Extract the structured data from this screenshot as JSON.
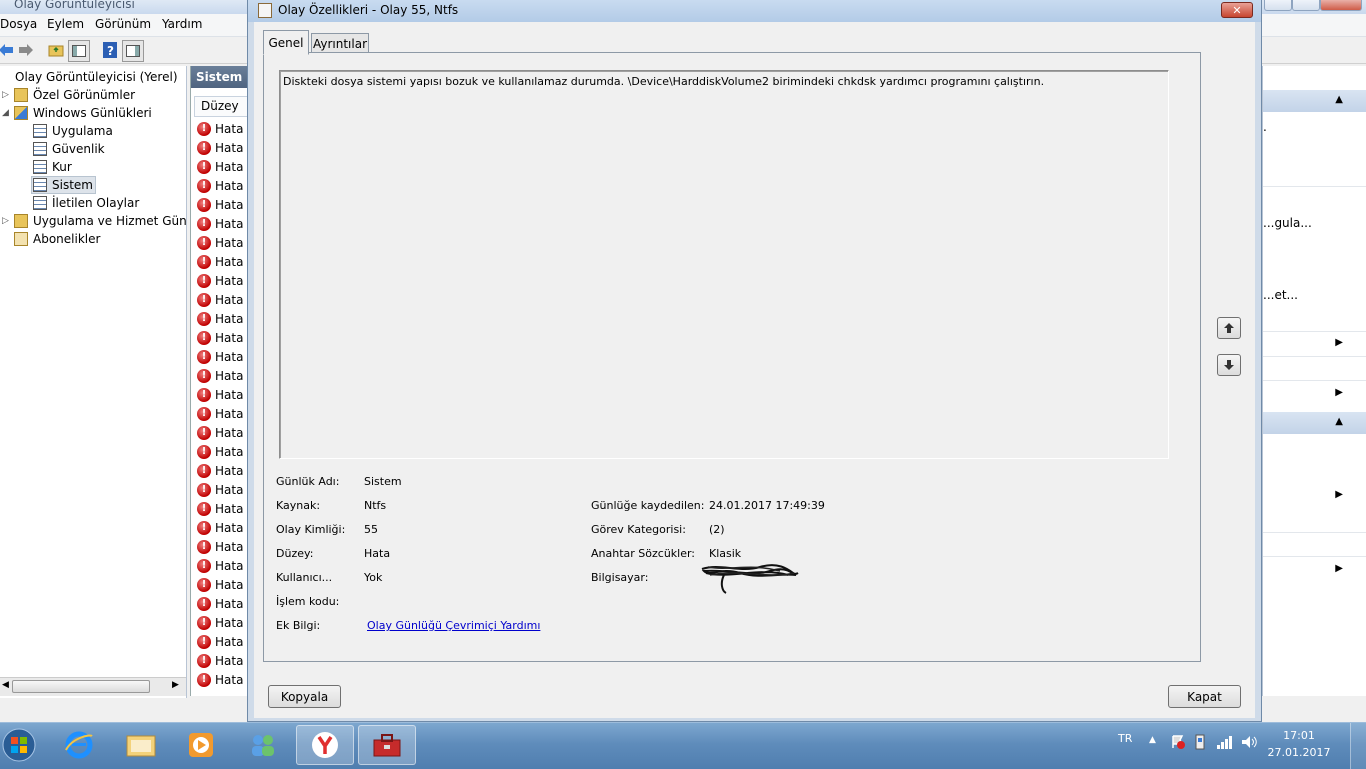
{
  "main_window": {
    "title": "Olay Görüntüleyicisi",
    "menu": [
      "Dosya",
      "Eylem",
      "Görünüm",
      "Yardım"
    ],
    "tree": {
      "root": "Olay Görüntüleyicisi (Yerel)",
      "custom_views": "Özel Görünümler",
      "windows_logs": "Windows Günlükleri",
      "logs": [
        "Uygulama",
        "Güvenlik",
        "Kur",
        "Sistem",
        "İletilen Olaylar"
      ],
      "app_service_logs": "Uygulama ve Hizmet Günlük",
      "subscriptions": "Abonelikler"
    },
    "middle_pane": {
      "header": "Sistem",
      "column": "Düzey",
      "row_level": "Hata"
    },
    "actions": {
      "item_1": "...gula...",
      "item_2": "...et...",
      "partial_dot": "."
    }
  },
  "dialog": {
    "title": "Olay Özellikleri - Olay 55, Ntfs",
    "tabs": [
      "Genel",
      "Ayrıntılar"
    ],
    "description": "Diskteki dosya sistemi yapısı bozuk ve kullanılamaz durumda. \\Device\\HarddiskVolume2 birimindeki chkdsk yardımcı programını çalıştırın.",
    "fields": {
      "log_name_label": "Günlük Adı:",
      "log_name": "Sistem",
      "source_label": "Kaynak:",
      "source": "Ntfs",
      "event_id_label": "Olay Kimliği:",
      "event_id": "55",
      "level_label": "Düzey:",
      "level": "Hata",
      "user_label": "Kullanıcı...",
      "user": "Yok",
      "opcode_label": "İşlem kodu:",
      "more_info_label": "Ek Bilgi:",
      "more_info_link": "Olay Günlüğü Çevrimiçi Yardımı",
      "logged_label": "Günlüğe kaydedilen:",
      "logged": "24.01.2017 17:49:39",
      "task_category_label": "Görev Kategorisi:",
      "task_category": "(2)",
      "keywords_label": "Anahtar Sözcükler:",
      "keywords": "Klasik",
      "computer_label": "Bilgisayar:"
    },
    "copy_button": "Kopyala",
    "close_button": "Kapat"
  },
  "taskbar": {
    "language": "TR",
    "time": "17:01",
    "date": "27.01.2017"
  },
  "colors": {
    "taskbar": "#5f8cbb",
    "error_icon": "#c00000",
    "link": "#0000cc"
  }
}
